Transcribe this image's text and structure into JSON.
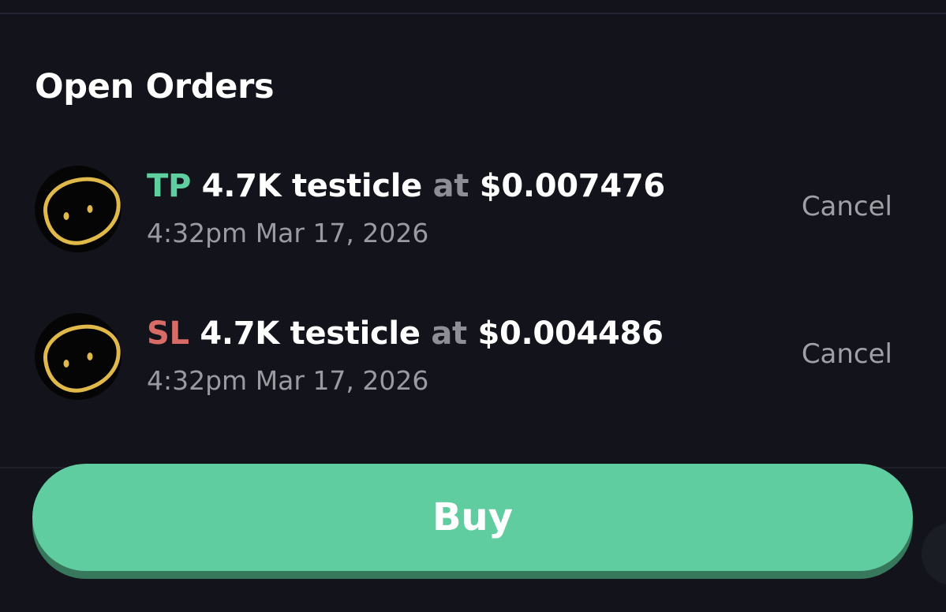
{
  "section": {
    "title": "Open Orders"
  },
  "orders": [
    {
      "type": "TP",
      "amount": "4.7K testicle",
      "at": "at",
      "price": "$0.007476",
      "time": "4:32pm Mar 17, 2026",
      "cancel_label": "Cancel",
      "type_color": "#5fcfa0",
      "icon": "token-face-icon"
    },
    {
      "type": "SL",
      "amount": "4.7K testicle",
      "at": "at",
      "price": "$0.004486",
      "time": "4:32pm Mar 17, 2026",
      "cancel_label": "Cancel",
      "type_color": "#d96b66",
      "icon": "token-face-icon"
    }
  ],
  "actions": {
    "buy_label": "Buy",
    "buy_color": "#60cda1"
  }
}
